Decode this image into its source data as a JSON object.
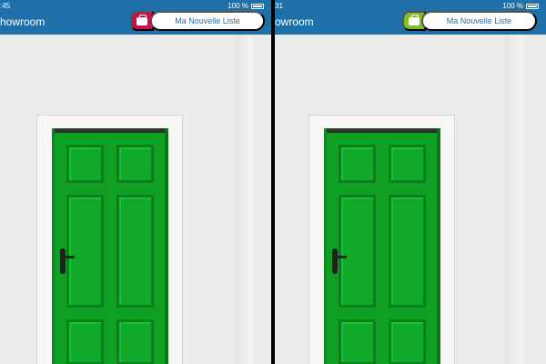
{
  "screens": [
    {
      "status_time": ":45",
      "battery": "100 %",
      "app_title": "howroom",
      "list_button": "Ma Nouvelle Liste",
      "bag_color": "#c8104f"
    },
    {
      "status_time": "31",
      "battery": "100 %",
      "app_title": "owroom",
      "list_button": "Ma Nouvelle Liste",
      "bag_color": "#7fbf2a"
    }
  ],
  "icons": {
    "bag": "shopping-bag-icon",
    "battery": "battery-icon"
  },
  "colors": {
    "header": "#1f6fa8",
    "door": "#0f9f23",
    "wall": "#e9e9e8"
  }
}
